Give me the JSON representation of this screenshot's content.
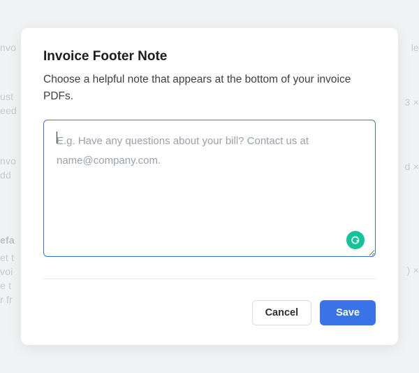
{
  "modal": {
    "title": "Invoice Footer Note",
    "description": "Choose a helpful note that appears at the bottom of your invoice PDFs.",
    "textarea": {
      "value": "",
      "placeholder": "E.g. Have any questions about your bill? Contact us at name@company.com."
    },
    "actions": {
      "cancel_label": "Cancel",
      "save_label": "Save"
    }
  },
  "bg": {
    "t1": "nvo",
    "t2": "ust",
    "t3": "eed",
    "t4": "nvo",
    "t5": "dd",
    "t6": "efa",
    "t7": "et t",
    "t8": "voi",
    "t9": "e t",
    "t10": "r fr",
    "t11": "le",
    "t12": "3  ×",
    "t13": "d  ×",
    "t14": ")  ×"
  }
}
